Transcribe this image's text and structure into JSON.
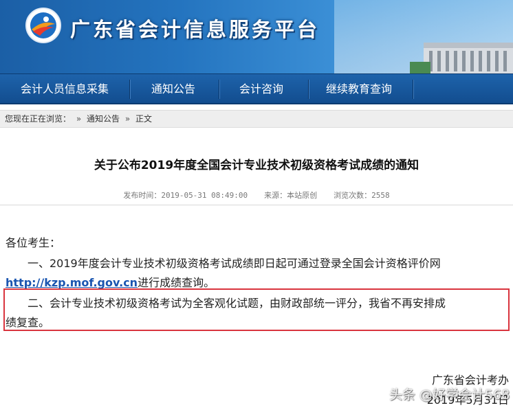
{
  "header": {
    "site_title": "广东省会计信息服务平台"
  },
  "nav": {
    "items": [
      {
        "label": "会计人员信息采集"
      },
      {
        "label": "通知公告"
      },
      {
        "label": "会计咨询"
      },
      {
        "label": "继续教育查询"
      }
    ]
  },
  "breadcrumb": {
    "prefix": "您现在正在浏览：",
    "sep": "»",
    "items": [
      "通知公告",
      "正文"
    ]
  },
  "article": {
    "title": "关于公布2019年度全国会计专业技术初级资格考试成绩的通知",
    "meta": {
      "publish_label": "发布时间：",
      "publish_time": "2019-05-31 08:49:00",
      "source_label": "来源：",
      "source": "本站原创",
      "views_label": "浏览次数：",
      "views": "2558"
    },
    "greeting": "各位考生：",
    "para1_line1": "一、2019年度会计专业技术初级资格考试成绩即日起可通过登录全国会计资格评价网",
    "para1_link": "http://kzp.mof.gov.cn",
    "para1_line2_rest": "进行成绩查询。",
    "para2_line1": "二、会计专业技术初级资格考试为全客观化试题，由财政部统一评分，我省不再安排成",
    "para2_line2": "绩复查。",
    "signature_org": "广东省会计考办",
    "signature_date": "2019年5月31日"
  },
  "watermark": "头条 @好学会计568",
  "colors": {
    "nav_bg": "#1b5ca3",
    "link": "#1a55b0",
    "highlight_border": "#d9333d"
  }
}
